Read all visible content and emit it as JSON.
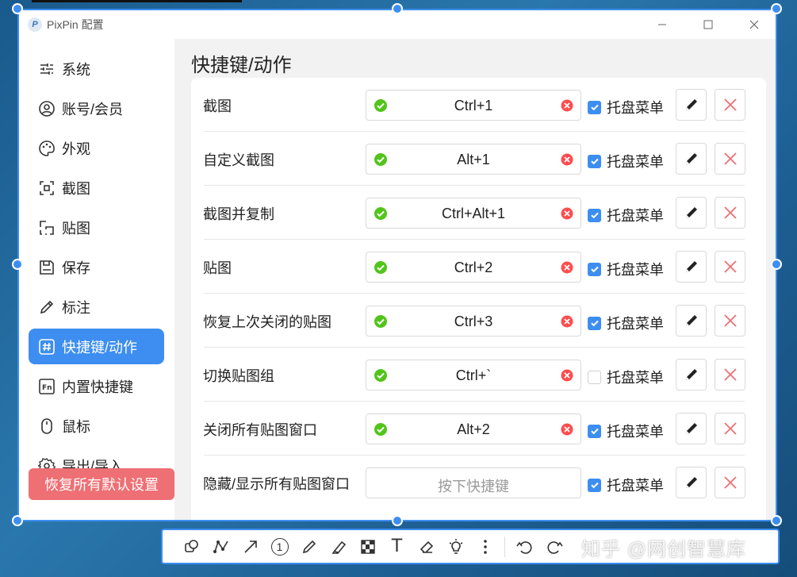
{
  "window": {
    "title": "PixPin 配置",
    "logo_letter": "P"
  },
  "sidebar": {
    "items": [
      {
        "label": "系统",
        "icon": "sliders-icon"
      },
      {
        "label": "账号/会员",
        "icon": "user-icon"
      },
      {
        "label": "外观",
        "icon": "palette-icon"
      },
      {
        "label": "截图",
        "icon": "crop-icon"
      },
      {
        "label": "贴图",
        "icon": "pin-icon"
      },
      {
        "label": "保存",
        "icon": "save-icon"
      },
      {
        "label": "标注",
        "icon": "pencil-icon"
      },
      {
        "label": "快捷键/动作",
        "icon": "hash-icon",
        "active": true
      },
      {
        "label": "内置快捷键",
        "icon": "fn-icon"
      },
      {
        "label": "鼠标",
        "icon": "mouse-icon"
      },
      {
        "label": "导出/导入",
        "icon": "gear-icon"
      }
    ],
    "reset_label": "恢复所有默认设置"
  },
  "main": {
    "title": "快捷键/动作",
    "tray_label": "托盘菜单",
    "rows": [
      {
        "name": "截图",
        "shortcut": "Ctrl+1",
        "has_key": true,
        "tray": true
      },
      {
        "name": "自定义截图",
        "shortcut": "Alt+1",
        "has_key": true,
        "tray": true
      },
      {
        "name": "截图并复制",
        "shortcut": "Ctrl+Alt+1",
        "has_key": true,
        "tray": true
      },
      {
        "name": "贴图",
        "shortcut": "Ctrl+2",
        "has_key": true,
        "tray": true
      },
      {
        "name": "恢复上次关闭的贴图",
        "shortcut": "Ctrl+3",
        "has_key": true,
        "tray": true
      },
      {
        "name": "切换贴图组",
        "shortcut": "Ctrl+`",
        "has_key": true,
        "tray": false
      },
      {
        "name": "关闭所有贴图窗口",
        "shortcut": "Alt+2",
        "has_key": true,
        "tray": true
      },
      {
        "name": "隐藏/显示所有贴图窗口",
        "shortcut": "按下快捷键",
        "has_key": false,
        "tray": true
      }
    ]
  },
  "toolbar": {
    "tools": [
      "shape-icon",
      "polyline-icon",
      "arrow-icon",
      "number-icon",
      "pencil-icon",
      "marker-icon",
      "mosaic-icon",
      "text-icon",
      "eraser-icon",
      "bulb-icon",
      "more-icon",
      "undo-icon",
      "redo-icon"
    ],
    "number_label": "1",
    "text_label": "T"
  },
  "watermark": "知乎 @网创智慧库",
  "colors": {
    "accent": "#3d8ef0",
    "danger": "#ee6f74",
    "ok": "#52c41a",
    "clear": "#ff4d4f"
  }
}
